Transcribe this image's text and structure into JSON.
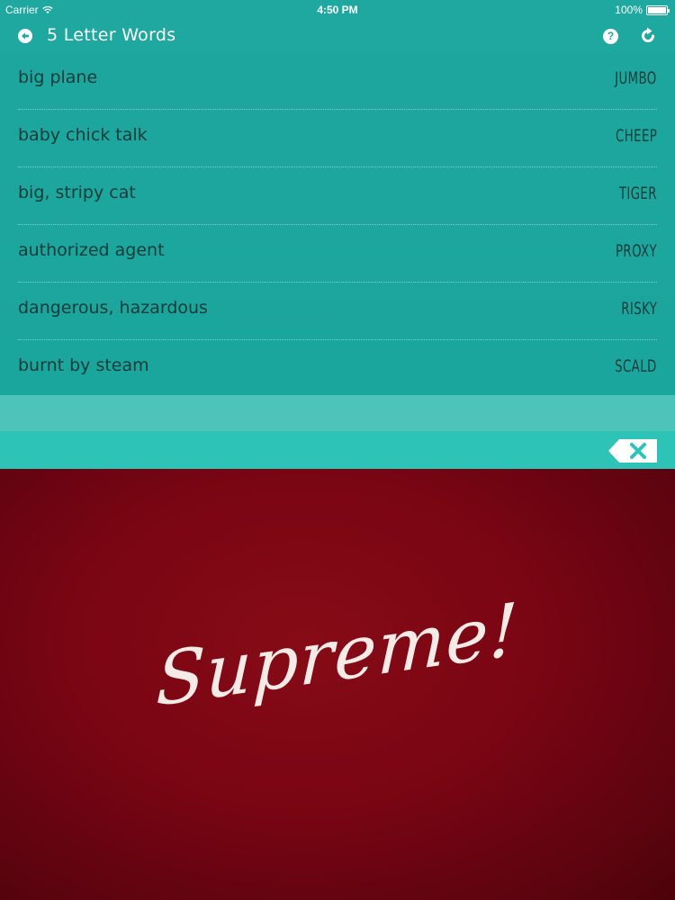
{
  "status_bar": {
    "carrier": "Carrier",
    "time": "4:50 PM",
    "battery": "100%",
    "battery_level": 1.0
  },
  "nav": {
    "title": "5 Letter Words",
    "back_icon": "back-arrow-icon",
    "help_label": "?",
    "refresh_icon": "refresh-icon"
  },
  "words": [
    {
      "clue": "big plane",
      "answer": "JUMBO"
    },
    {
      "clue": "baby chick talk",
      "answer": "CHEEP"
    },
    {
      "clue": "big, stripy cat",
      "answer": "TIGER"
    },
    {
      "clue": "authorized agent",
      "answer": "PROXY"
    },
    {
      "clue": "dangerous, hazardous",
      "answer": "RISKY"
    },
    {
      "clue": "burnt by steam",
      "answer": "SCALD"
    }
  ],
  "input": {
    "value": "",
    "backspace_icon": "backspace-icon"
  },
  "result": {
    "message": "Supreme!"
  },
  "colors": {
    "teal": "#1fa89f",
    "teal_light": "#4ec3ba",
    "input_teal": "#2dc4b7",
    "text_dark": "#123c39",
    "crimson": "#7a0513"
  }
}
